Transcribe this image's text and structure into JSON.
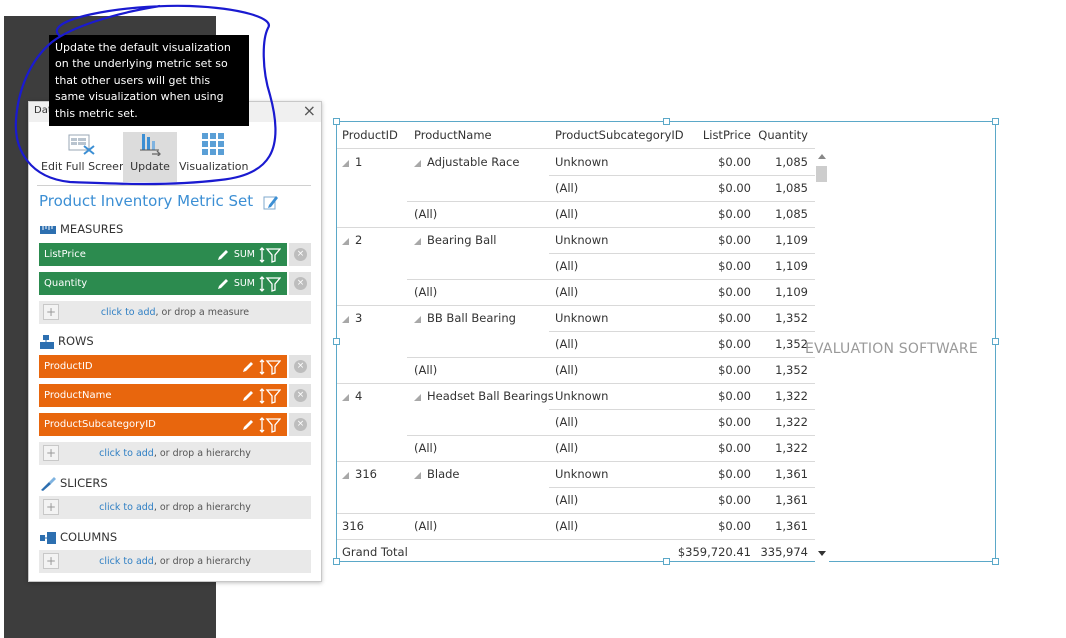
{
  "panel": {
    "title_fragment": "Dat",
    "close_glyph": "×",
    "toolbar": [
      {
        "label": "Edit Full Screen",
        "icon": "edit-fullscreen-icon"
      },
      {
        "label": "Update",
        "icon": "update-icon",
        "active": true
      },
      {
        "label": "Visualization",
        "icon": "visualization-grid-icon"
      }
    ],
    "metric_set_title": "Product Inventory Metric Set",
    "measures": {
      "heading": "MEASURES",
      "items": [
        {
          "label": "ListPrice",
          "aggregation": "SUM"
        },
        {
          "label": "Quantity",
          "aggregation": "SUM"
        }
      ],
      "drop_link": "click to add",
      "drop_text": ", or drop a measure"
    },
    "rows": {
      "heading": "ROWS",
      "items": [
        {
          "label": "ProductID"
        },
        {
          "label": "ProductName"
        },
        {
          "label": "ProductSubcategoryID"
        }
      ],
      "drop_link": "click to add",
      "drop_text": ", or drop a hierarchy"
    },
    "slicers": {
      "heading": "SLICERS",
      "drop_link": "click to add",
      "drop_text": ", or drop a hierarchy"
    },
    "columns": {
      "heading": "COLUMNS",
      "drop_link": "click to add",
      "drop_text": ", or drop a hierarchy"
    },
    "remove_glyph": "×",
    "plus_glyph": "+"
  },
  "tooltip": {
    "text": "Update the default visualization on the underlying metric set so that other users will get this same visualization when using this metric set."
  },
  "grid": {
    "headers": [
      "ProductID",
      "ProductName",
      "ProductSubcategoryID",
      "ListPrice",
      "Quantity"
    ],
    "rows": [
      {
        "id": "1",
        "name": "Adjustable Race",
        "sub": "Unknown",
        "price": "$0.00",
        "qty": "1,085"
      },
      {
        "id": "",
        "name": "",
        "sub": "(All)",
        "price": "$0.00",
        "qty": "1,085"
      },
      {
        "id": "",
        "name": "(All)",
        "sub": "(All)",
        "price": "$0.00",
        "qty": "1,085"
      },
      {
        "id": "2",
        "name": "Bearing Ball",
        "sub": "Unknown",
        "price": "$0.00",
        "qty": "1,109"
      },
      {
        "id": "",
        "name": "",
        "sub": "(All)",
        "price": "$0.00",
        "qty": "1,109"
      },
      {
        "id": "",
        "name": "(All)",
        "sub": "(All)",
        "price": "$0.00",
        "qty": "1,109"
      },
      {
        "id": "3",
        "name": "BB Ball Bearing",
        "sub": "Unknown",
        "price": "$0.00",
        "qty": "1,352"
      },
      {
        "id": "",
        "name": "",
        "sub": "(All)",
        "price": "$0.00",
        "qty": "1,352"
      },
      {
        "id": "",
        "name": "(All)",
        "sub": "(All)",
        "price": "$0.00",
        "qty": "1,352"
      },
      {
        "id": "4",
        "name": "Headset Ball Bearings",
        "sub": "Unknown",
        "price": "$0.00",
        "qty": "1,322"
      },
      {
        "id": "",
        "name": "",
        "sub": "(All)",
        "price": "$0.00",
        "qty": "1,322"
      },
      {
        "id": "",
        "name": "(All)",
        "sub": "(All)",
        "price": "$0.00",
        "qty": "1,322"
      },
      {
        "id": "316",
        "name": "Blade",
        "sub": "Unknown",
        "price": "$0.00",
        "qty": "1,361"
      },
      {
        "id": "",
        "name": "",
        "sub": "(All)",
        "price": "$0.00",
        "qty": "1,361"
      },
      {
        "id": "316",
        "name": "(All)",
        "sub": "(All)",
        "price": "$0.00",
        "qty": "1,361"
      }
    ],
    "total": {
      "label": "Grand Total",
      "price": "$359,720.41",
      "qty": "335,974"
    }
  },
  "watermark": "EVALUATION SOFTWARE",
  "colors": {
    "measure_pill": "#2c8b4f",
    "row_pill": "#e8660d",
    "link": "#2f7fc4",
    "title": "#3c8fd4",
    "selection_border": "#5ba8c8",
    "annotation_circle": "#1a1ad0"
  }
}
